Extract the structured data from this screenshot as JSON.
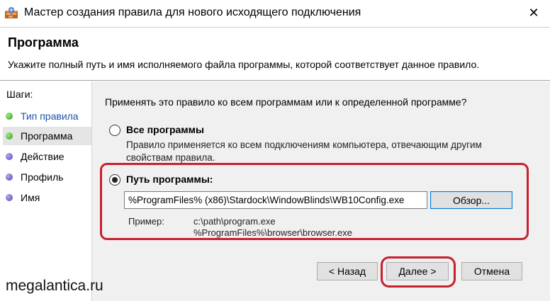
{
  "window": {
    "title": "Мастер создания правила для нового исходящего подключения",
    "close_glyph": "✕",
    "icon": "firewall-wizard-icon"
  },
  "header": {
    "title": "Программа",
    "subtitle": "Укажите полный путь и имя исполняемого файла программы, которой соответствует данное правило."
  },
  "steps": {
    "title": "Шаги:",
    "items": [
      {
        "label": "Тип правила",
        "state": "done"
      },
      {
        "label": "Программа",
        "state": "current"
      },
      {
        "label": "Действие",
        "state": "todo"
      },
      {
        "label": "Профиль",
        "state": "todo"
      },
      {
        "label": "Имя",
        "state": "todo"
      }
    ]
  },
  "main": {
    "question": "Применять это правило ко всем программам или к определенной программе?",
    "all_programs": {
      "label": "Все программы",
      "description_line1": "Правило применяется ко всем подключениям компьютера, отвечающим другим",
      "description_line2": "свойствам правила.",
      "checked": false
    },
    "program_path": {
      "label": "Путь программы:",
      "checked": true,
      "value": "%ProgramFiles% (x86)\\Stardock\\WindowBlinds\\WB10Config.exe",
      "browse_label": "Обзор...",
      "example_label": "Пример:",
      "example_line1": "c:\\path\\program.exe",
      "example_line2": "%ProgramFiles%\\browser\\browser.exe"
    }
  },
  "buttons": {
    "back": "< Назад",
    "next": "Далее >",
    "cancel": "Отмена"
  },
  "watermark": "megalantica.ru",
  "colors": {
    "highlight": "#c8202e",
    "step_done_text": "#1a53a6",
    "step_done_dot": "#2f9a1a",
    "step_todo_dot": "#5b3fb8",
    "focus_border": "#0078d7"
  }
}
